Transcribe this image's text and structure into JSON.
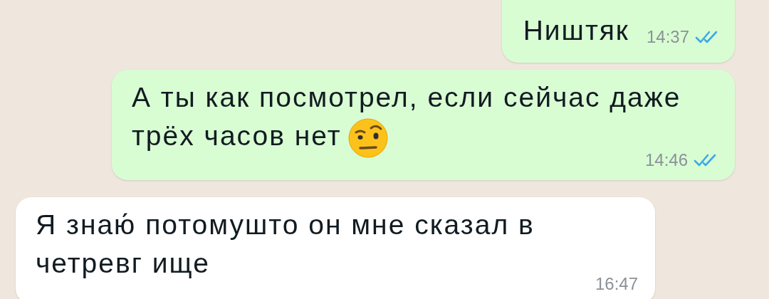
{
  "messages": [
    {
      "kind": "outgoing",
      "text": "Ништяк",
      "time": "14:37",
      "read": true
    },
    {
      "kind": "outgoing",
      "text": "А ты как посмотрел, если сейчас даже трёх часов нет",
      "time": "14:46",
      "read": true,
      "emoji": true
    },
    {
      "kind": "incoming",
      "text": "Я знаю́ потомушто он мне сказал в четревг ище",
      "time": "16:47"
    }
  ]
}
